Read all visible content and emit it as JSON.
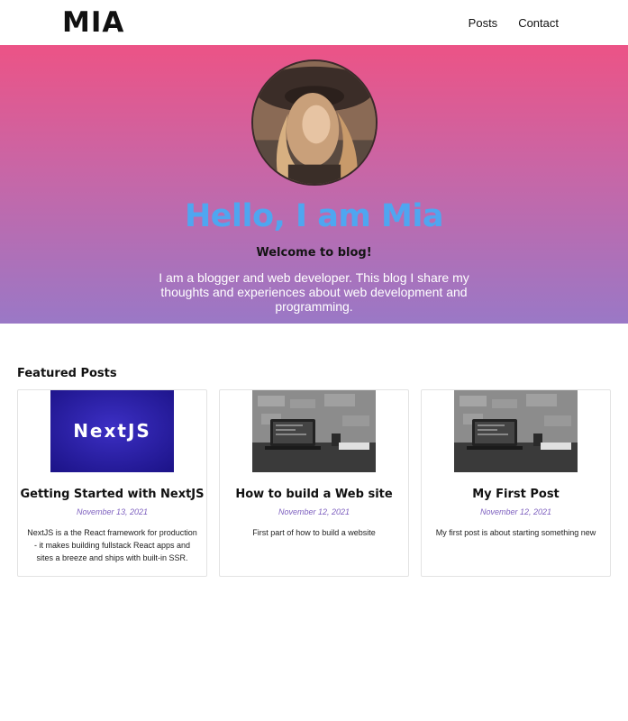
{
  "header": {
    "logo": "MIA",
    "nav": [
      {
        "label": "Posts"
      },
      {
        "label": "Contact"
      }
    ]
  },
  "hero": {
    "title": "Hello, I am Mia",
    "subtitle": "Welcome to blog!",
    "description": "I am a blogger and web developer. This blog I share my thoughts and experiences about web development and programming.",
    "colors": {
      "gradient_top": "#ec5386",
      "gradient_bottom": "#9a78c6",
      "title": "#4fa6f0"
    }
  },
  "featured": {
    "heading": "Featured Posts",
    "posts": [
      {
        "title": "Getting Started with NextJS",
        "date": "November 13, 2021",
        "excerpt": "NextJS is a the React framework for production - it makes building fullstack React apps and sites a breeze and ships with built-in SSR.",
        "image_text": "NextJS"
      },
      {
        "title": "How to build a Web site",
        "date": "November 12, 2021",
        "excerpt": "First part of how to build a website"
      },
      {
        "title": "My First Post",
        "date": "November 12, 2021",
        "excerpt": "My first post is about starting something new"
      }
    ],
    "colors": {
      "date": "#7d5fbf"
    }
  }
}
